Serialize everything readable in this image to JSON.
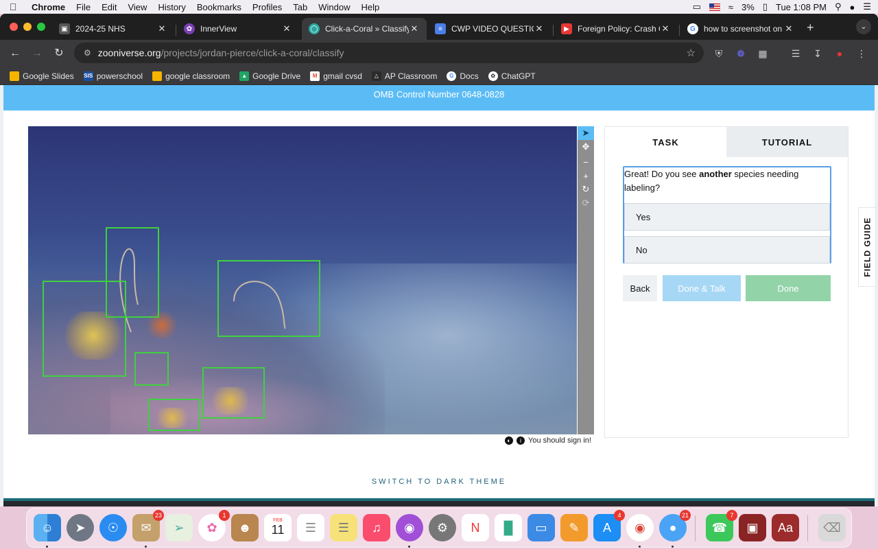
{
  "menubar": {
    "app": "Chrome",
    "items": [
      "File",
      "Edit",
      "View",
      "History",
      "Bookmarks",
      "Profiles",
      "Tab",
      "Window",
      "Help"
    ],
    "battery": "3%",
    "clock": "Tue 1:08 PM"
  },
  "tabs": [
    {
      "label": "2024-25 NHS",
      "icon_color": "#555555",
      "icon": "presentation-icon"
    },
    {
      "label": "InnerView",
      "icon_color": "#7a3fb5",
      "icon": "innerview-icon"
    },
    {
      "label": "Click-a-Coral » Classify",
      "icon_color": "#2aa8a0",
      "icon": "zooniverse-icon",
      "active": true
    },
    {
      "label": "CWP VIDEO QUESTIONS",
      "icon_color": "#4a7ee8",
      "icon": "docs-icon"
    },
    {
      "label": "Foreign Policy: Crash Co",
      "icon_color": "#e53935",
      "icon": "youtube-icon"
    },
    {
      "label": "how to screenshot on m",
      "icon_color": "#ffffff",
      "icon": "google-icon"
    }
  ],
  "address": {
    "domain": "zooniverse.org",
    "path": "/projects/jordan-pierce/click-a-coral/classify"
  },
  "bookmarks": [
    {
      "label": "Google Slides",
      "color": "#f4b400",
      "icon": "slides-icon"
    },
    {
      "label": "powerschool",
      "color": "#1b4fa0",
      "icon": "powerschool-icon",
      "glyph": "SIS"
    },
    {
      "label": "google classroom",
      "color": "#f4b400",
      "icon": "classroom-icon"
    },
    {
      "label": "Google Drive",
      "color": "#1fa463",
      "icon": "drive-icon"
    },
    {
      "label": "gmail cvsd",
      "color": "#ea4335",
      "icon": "gmail-icon",
      "glyph": "M"
    },
    {
      "label": "AP Classroom",
      "color": "#2b2b2b",
      "icon": "ap-classroom-icon"
    },
    {
      "label": "Docs",
      "color": "#ffffff",
      "icon": "google-icon",
      "glyph": "G"
    },
    {
      "label": "ChatGPT",
      "color": "#ffffff",
      "icon": "chatgpt-icon"
    }
  ],
  "page": {
    "omb_notice": "OMB Control Number 0648-0828",
    "signin_hint": "You should sign in!",
    "dark_theme_link": "SWITCH TO DARK THEME"
  },
  "task": {
    "tabs": [
      "TASK",
      "TUTORIAL"
    ],
    "question_pre": "Great! Do you see ",
    "question_bold": "another",
    "question_post": " species needing labeling?",
    "answers": [
      "Yes",
      "No"
    ],
    "buttons": {
      "back": "Back",
      "done_talk": "Done & Talk",
      "done": "Done"
    }
  },
  "field_guide": "FIELD GUIDE",
  "dock": {
    "badges": {
      "mail_app": "23",
      "photos": "1",
      "calendar_day": "11",
      "calendar_month": "FEB",
      "appstore": "4",
      "messages": "21",
      "facetime": "7"
    }
  },
  "colors": {
    "accent_blue": "#5bbcf5",
    "bbox_green": "#3fd13f",
    "done_talk_bg": "#a6d7f5",
    "done_bg": "#93d3a8"
  }
}
